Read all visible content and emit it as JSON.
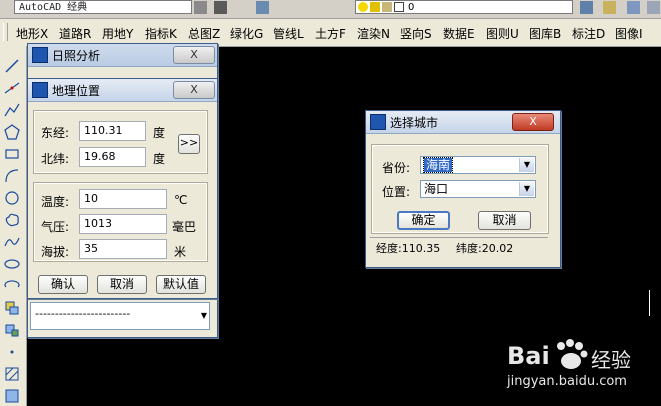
{
  "toolbar": {
    "workspace_value": "AutoCAD 经典",
    "layer_value": "0"
  },
  "menus": [
    "地形X",
    "道路R",
    "用地Y",
    "指标K",
    "总图Z",
    "绿化G",
    "管线L",
    "土方F",
    "渲染N",
    "竖向S",
    "数据E",
    "图则U",
    "图库B",
    "标注D",
    "图像I"
  ],
  "sunlight_dialog": {
    "title": "日照分析",
    "close_label": "X",
    "dash_line": "------------------------"
  },
  "geo_dialog": {
    "title": "地理位置",
    "close_label": "X",
    "longitude_label": "东经:",
    "longitude_value": "110.31",
    "longitude_unit": "度",
    "latitude_label": "北纬:",
    "latitude_value": "19.68",
    "latitude_unit": "度",
    "expand_label": ">>",
    "temperature_label": "温度:",
    "temperature_value": "10",
    "temperature_unit": "℃",
    "pressure_label": "气压:",
    "pressure_value": "1013",
    "pressure_unit": "毫巴",
    "altitude_label": "海拔:",
    "altitude_value": "35",
    "altitude_unit": "米",
    "ok_label": "确认",
    "cancel_label": "取消",
    "default_label": "默认值"
  },
  "city_dialog": {
    "title": "选择城市",
    "close_label": "X",
    "province_label": "省份:",
    "province_value": "海南",
    "position_label": "位置:",
    "position_value": "海口",
    "ok_label": "确定",
    "cancel_label": "取消",
    "status_longitude": "经度:110.35",
    "status_latitude": "纬度:20.02"
  },
  "watermark": {
    "brand": "Bai",
    "brand2": "经验",
    "url": "jingyan.baidu.com"
  }
}
